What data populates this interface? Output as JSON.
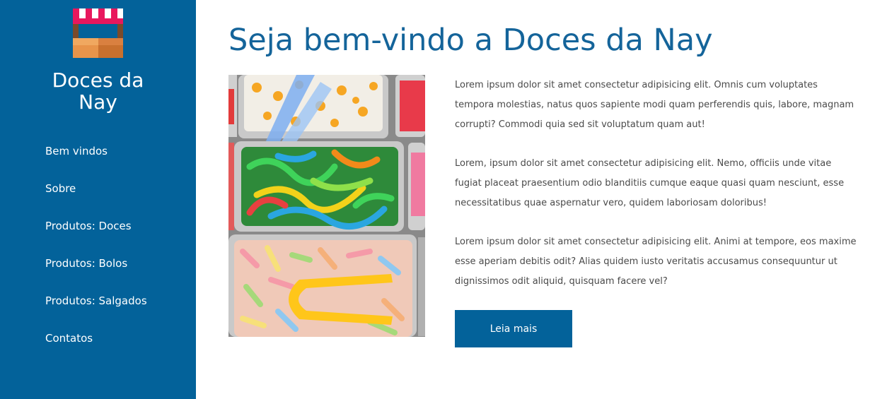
{
  "brand": {
    "line1": "Doces da",
    "line2": "Nay",
    "logo_icon": "candy-shop-stall-icon"
  },
  "nav": {
    "items": [
      {
        "label": "Bem vindos"
      },
      {
        "label": "Sobre"
      },
      {
        "label": "Produtos: Doces"
      },
      {
        "label": "Produtos: Bolos"
      },
      {
        "label": "Produtos: Salgados"
      },
      {
        "label": "Contatos"
      }
    ]
  },
  "main": {
    "title": "Seja bem-vindo a Doces da Nay",
    "image_alt": "Bandejas de balas de gelatina coloridas com pegadores",
    "paragraphs": [
      "Lorem ipsum dolor sit amet consectetur adipisicing elit. Omnis cum voluptates tempora molestias, natus quos sapiente modi quam perferendis quis, labore, magnam corrupti? Commodi quia sed sit voluptatum quam aut!",
      "Lorem, ipsum dolor sit amet consectetur adipisicing elit. Nemo, officiis unde vitae fugiat placeat praesentium odio blanditiis cumque eaque quasi quam nesciunt, esse necessitatibus quae aspernatur vero, quidem laboriosam doloribus!",
      "Lorem ipsum dolor sit amet consectetur adipisicing elit. Animi at tempore, eos maxime esse aperiam debitis odit? Alias quidem iusto veritatis accusamus consequuntur ut dignissimos odit aliquid, quisquam facere vel?"
    ],
    "button_label": "Leia mais"
  },
  "colors": {
    "sidebar": "#03629a",
    "title": "#14649a",
    "body_text": "#4a4a4a",
    "button": "#03629a"
  }
}
